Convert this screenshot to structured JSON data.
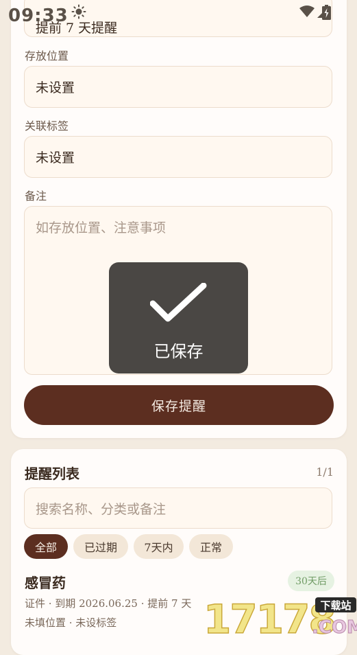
{
  "status_bar": {
    "time": "09:33",
    "icons": [
      "sun-icon",
      "wifi-icon",
      "signal-icon",
      "battery-icon"
    ]
  },
  "form": {
    "reminder_field_value": "提前 7 天提醒",
    "location_label": "存放位置",
    "location_value": "未设置",
    "tag_label": "关联标签",
    "tag_value": "未设置",
    "note_label": "备注",
    "note_placeholder": "如存放位置、注意事项",
    "save_button": "保存提醒"
  },
  "toast": {
    "icon": "checkmark-icon",
    "text": "已保存"
  },
  "list": {
    "title": "提醒列表",
    "count": "1/1",
    "search_placeholder": "搜索名称、分类或备注",
    "filters": [
      {
        "label": "全部",
        "active": true
      },
      {
        "label": "已过期",
        "active": false
      },
      {
        "label": "7天内",
        "active": false
      },
      {
        "label": "正常",
        "active": false
      }
    ],
    "items": [
      {
        "name": "感冒药",
        "badge": "30天后",
        "meta_line1": "证件 · 到期 2026.06.25 · 提前 7 天",
        "meta_line2": "未填位置 · 未设标签"
      }
    ]
  },
  "watermark": {
    "text": "17178",
    "tag": "下载站",
    "suffix": ".COM"
  },
  "colors": {
    "background": "#f3ebe0",
    "card": "#fffcfa",
    "field": "#fff8f0",
    "primary": "#5c2e20",
    "badge_bg": "#e6f2e2",
    "badge_text": "#6f9b64",
    "toast_bg": "#4a4744"
  }
}
